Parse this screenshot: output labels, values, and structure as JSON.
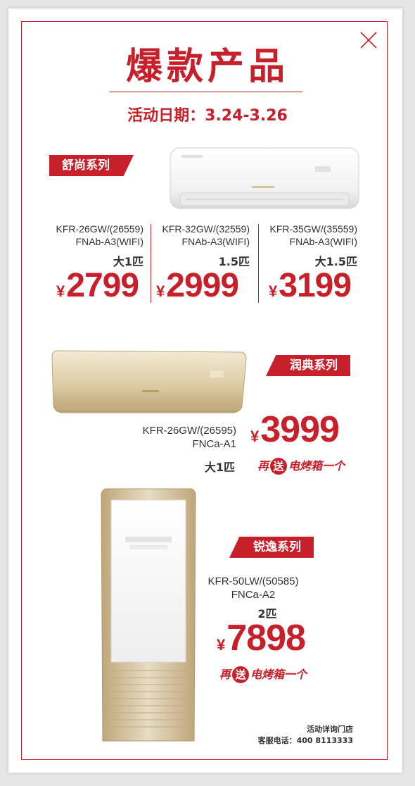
{
  "header": {
    "title": "爆款产品",
    "date": "活动日期：3.24-3.26"
  },
  "series1": {
    "tag": "舒尚系列",
    "products": [
      {
        "model_line1": "KFR-26GW/(26559)",
        "model_line2": "FNAb-A3(WIFI)",
        "hp": "大1匹",
        "price": "2799"
      },
      {
        "model_line1": "KFR-32GW/(32559)",
        "model_line2": "FNAb-A3(WIFI)",
        "hp": "1.5匹",
        "price": "2999"
      },
      {
        "model_line1": "KFR-35GW/(35559)",
        "model_line2": "FNAb-A3(WIFI)",
        "hp": "大1.5匹",
        "price": "3199"
      }
    ]
  },
  "series2": {
    "tag": "润典系列",
    "model_line1": "KFR-26GW/(26595)",
    "model_line2": "FNCa-A1",
    "hp": "大1匹",
    "price": "3999",
    "gift_pre": "再",
    "gift_circle": "送",
    "gift_post": "电烤箱一个"
  },
  "series3": {
    "tag": "锐逸系列",
    "model_line1": "KFR-50LW/(50585)",
    "model_line2": "FNCa-A2",
    "hp": "2匹",
    "price": "7898",
    "gift_pre": "再",
    "gift_circle": "送",
    "gift_post": "电烤箱一个"
  },
  "footer": {
    "line1": "活动详询门店",
    "line2": "客服电话：400 8113333"
  },
  "currency": "¥",
  "icons": {
    "close": "close-icon"
  },
  "colors": {
    "accent": "#c8202a",
    "gold": "#d9c49c"
  }
}
